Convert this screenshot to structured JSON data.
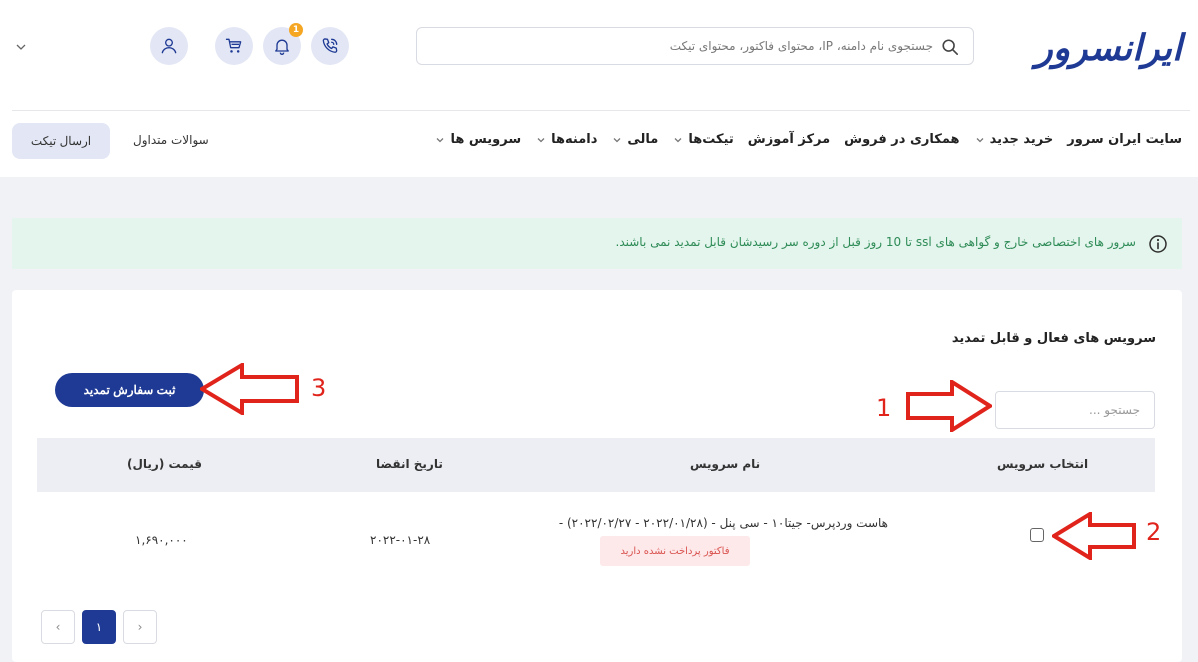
{
  "header": {
    "logo_text": "ایرانسرور",
    "search_placeholder": "جستجوی نام دامنه، IP، محتوای فاکتور، محتوای تیکت",
    "notification_count": "1"
  },
  "nav": {
    "items": [
      {
        "label": "سرویس ها",
        "has_dropdown": true
      },
      {
        "label": "دامنه‌ها",
        "has_dropdown": true
      },
      {
        "label": "مالی",
        "has_dropdown": true
      },
      {
        "label": "تیکت‌ها",
        "has_dropdown": true
      },
      {
        "label": "مرکز آموزش",
        "has_dropdown": false
      },
      {
        "label": "همکاری در فروش",
        "has_dropdown": false
      },
      {
        "label": "خرید جدید",
        "has_dropdown": true
      },
      {
        "label": "سایت ایران سرور",
        "has_dropdown": false
      }
    ],
    "faq_label": "سوالات متداول",
    "ticket_button": "ارسال تیکت"
  },
  "alert": {
    "text": "سرور های اختصاصی خارج و گواهی های ssl تا 10 روز قبل از دوره سر رسیدشان قابل تمدید نمی باشند."
  },
  "card": {
    "title": "سرویس های فعال و قابل تمدید",
    "search_placeholder": "جستجو ...",
    "submit_button": "ثبت سفارش تمدید",
    "columns": {
      "select": "انتخاب سرویس",
      "name": "نام سرویس",
      "expiry": "تاریخ انقضا",
      "price": "قیمت (ریال)"
    },
    "rows": [
      {
        "name": "هاست وردپرس- جیتا۱۰ - سی پنل - (۲۰۲۲/۰۱/۲۸ - ۲۰۲۲/۰۲/۲۷) -",
        "badge": "فاکتور پرداخت نشده دارید",
        "expiry": "۲۰۲۲-۰۱-۲۸",
        "price": "۱,۶۹۰,۰۰۰"
      }
    ],
    "pagination": {
      "current": "۱",
      "prev": "‹",
      "next": "›"
    }
  },
  "annotations": {
    "one": "1",
    "two": "2",
    "three": "3"
  },
  "colors": {
    "brand": "#1f3a94",
    "alert_bg": "#e3f5ec",
    "alert_text": "#2e8b57",
    "annotation": "#e0241c"
  }
}
